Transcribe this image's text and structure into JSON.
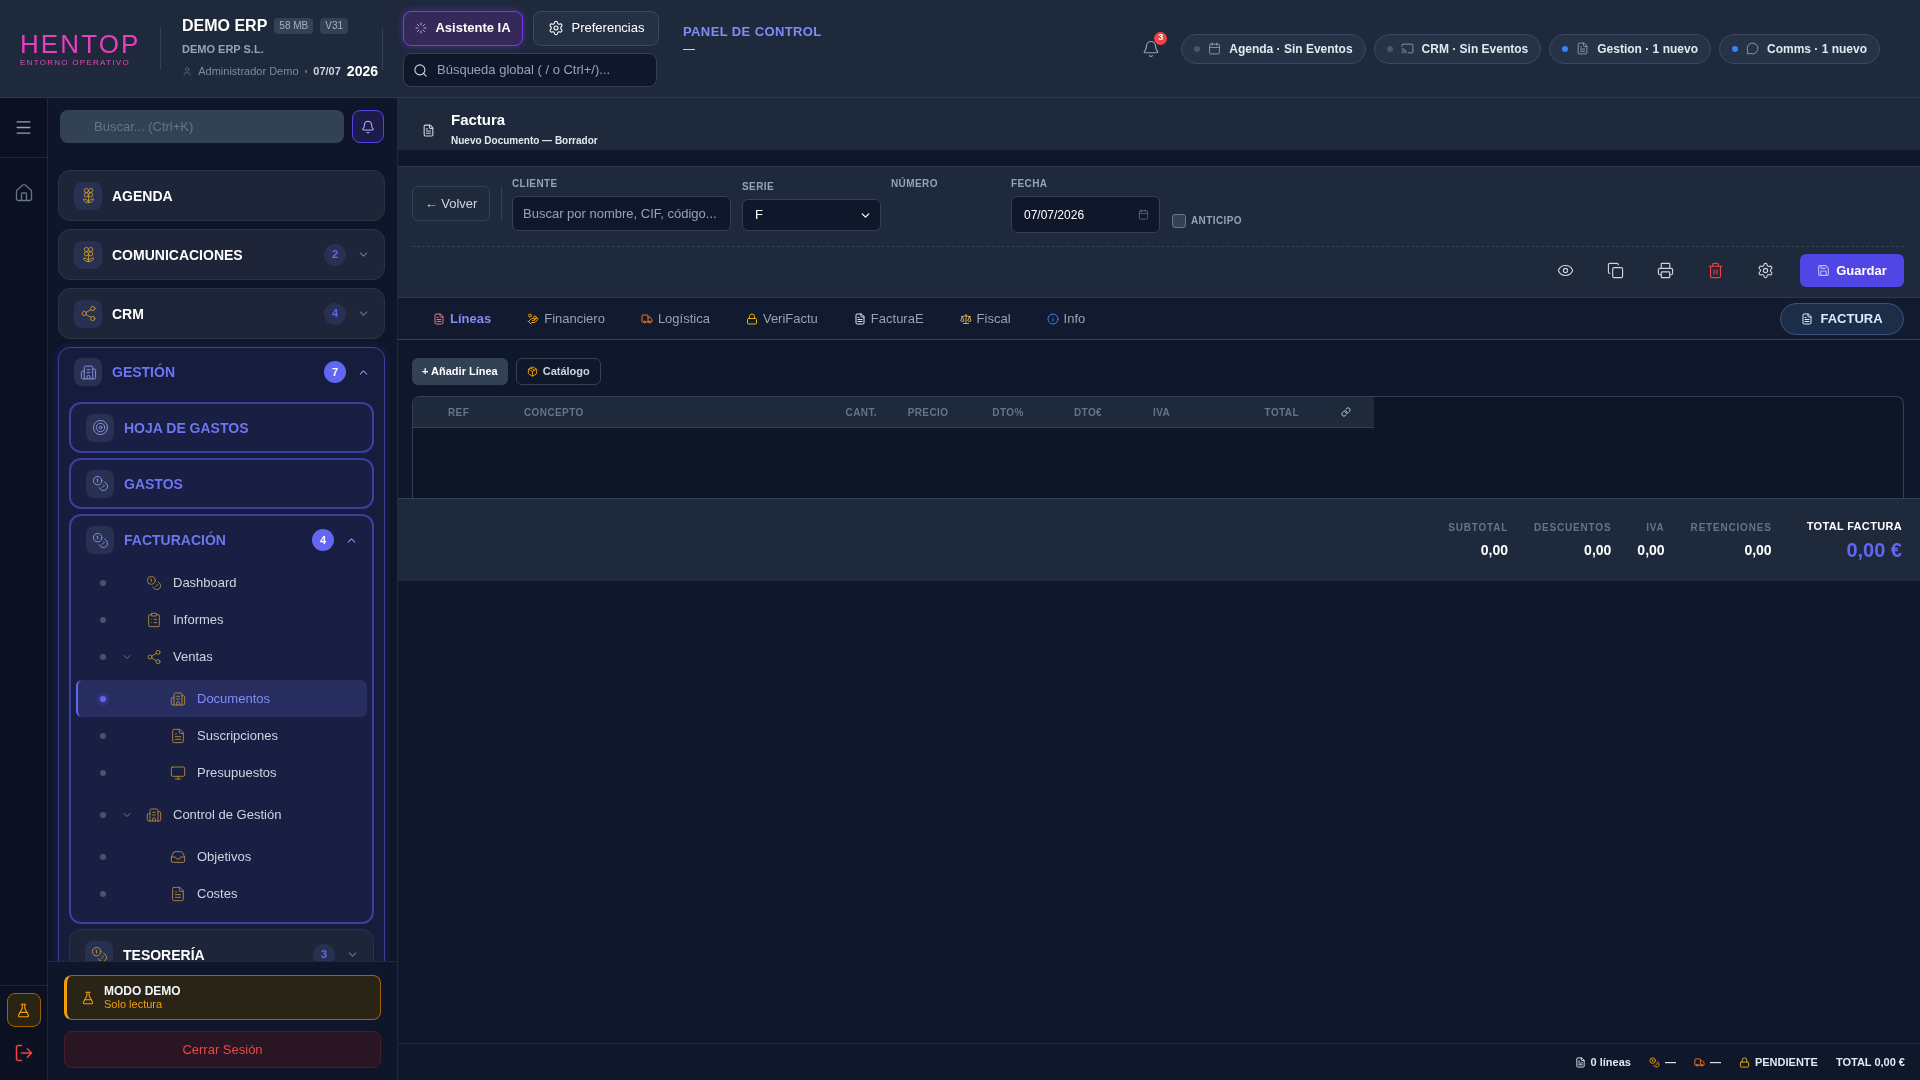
{
  "header": {
    "logo": {
      "name": "HENTOP",
      "tagline": "ENTORNO OPERATIVO"
    },
    "company": {
      "name": "DEMO ERP",
      "badges": [
        "58 MB",
        "V31"
      ],
      "legal_name": "DEMO ERP S.L.",
      "user": "Administrador Demo",
      "date": "07/07",
      "year": "2026"
    },
    "buttons": [
      {
        "label": "Asistente IA",
        "kind": "assistant"
      },
      {
        "label": "Preferencias",
        "kind": "settings"
      }
    ],
    "search": {
      "placeholder": "Búsqueda global ( / o Ctrl+/)..."
    },
    "page": {
      "title": "PANEL DE CONTROL",
      "subtitle": "—"
    },
    "notifications": {
      "count": "3"
    },
    "status_pills": [
      {
        "label": "Agenda · Sin Eventos",
        "kind": "calendar",
        "color": "#475569"
      },
      {
        "label": "CRM · Sin Eventos",
        "kind": "screen",
        "color": "#475569"
      },
      {
        "label": "Gestion · 1 nuevo",
        "kind": "document",
        "color": "#3b82f6"
      },
      {
        "label": "Comms · 1 nuevo",
        "kind": "chat",
        "color": "#3b82f6"
      }
    ]
  },
  "sidebar": {
    "search": {
      "placeholder": "Buscar... (Ctrl+K)"
    },
    "nav": [
      {
        "label": "AGENDA",
        "kind": "link",
        "active": false,
        "expanded": false
      },
      {
        "label": "COMUNICACIONES",
        "kind": "group",
        "count": "2",
        "active": false,
        "expanded": false
      },
      {
        "label": "CRM",
        "kind": "group",
        "count": "4",
        "active": false,
        "expanded": false
      },
      {
        "label": "GESTIÓN",
        "kind": "group",
        "count": "7",
        "active": true,
        "expanded": true,
        "children": [
          {
            "label": "HOJA DE GASTOS",
            "kind": "link",
            "active": true,
            "expanded": false
          },
          {
            "label": "GASTOS",
            "kind": "link",
            "active": true,
            "expanded": false
          },
          {
            "label": "FACTURACIÓN",
            "kind": "group",
            "count": "4",
            "active": true,
            "expanded": true,
            "children": [
              {
                "label": "Dashboard",
                "kind": "page",
                "selected": false,
                "expanded": false
              },
              {
                "label": "Informes",
                "kind": "page",
                "selected": false,
                "expanded": false
              },
              {
                "label": "Ventas",
                "kind": "folder",
                "selected": false,
                "expanded": true,
                "children": [
                  {
                    "label": "Documentos",
                    "kind": "page",
                    "selected": true,
                    "expanded": false
                  },
                  {
                    "label": "Suscripciones",
                    "kind": "page",
                    "selected": false,
                    "expanded": false
                  },
                  {
                    "label": "Presupuestos",
                    "kind": "page",
                    "selected": false,
                    "expanded": false
                  }
                ]
              },
              {
                "label": "Control de Gestión",
                "kind": "folder",
                "selected": false,
                "expanded": true,
                "children": [
                  {
                    "label": "Objetivos",
                    "kind": "page",
                    "selected": false,
                    "expanded": false
                  },
                  {
                    "label": "Costes",
                    "kind": "page",
                    "selected": false,
                    "expanded": false
                  }
                ]
              }
            ]
          },
          {
            "label": "TESORERÍA",
            "kind": "group",
            "count": "3",
            "active": false,
            "expanded": false
          }
        ]
      }
    ],
    "demo": {
      "title": "MODO DEMO",
      "subtitle": "Solo lectura"
    },
    "logout": "Cerrar Sesión"
  },
  "document": {
    "title": "Factura",
    "subtitle": "Nuevo Documento — Borrador"
  },
  "form": {
    "back_button": "← Volver",
    "fields": [
      {
        "label": "CLIENTE",
        "kind": "search",
        "placeholder": "Buscar por nombre, CIF, código..."
      },
      {
        "label": "SERIE",
        "kind": "select",
        "value": "F"
      },
      {
        "label": "NÚMERO",
        "kind": "readonly"
      },
      {
        "label": "FECHA",
        "kind": "date",
        "value": "07/07/2026"
      }
    ],
    "anticipo": {
      "label": "ANTICIPO",
      "checked": false
    },
    "save_button": "Guardar"
  },
  "tabs": [
    {
      "label": "Líneas",
      "selected": true
    },
    {
      "label": "Financiero",
      "selected": false
    },
    {
      "label": "Logística",
      "selected": false
    },
    {
      "label": "VeriFactu",
      "selected": false
    },
    {
      "label": "FacturaE",
      "selected": false
    },
    {
      "label": "Fiscal",
      "selected": false
    },
    {
      "label": "Info",
      "selected": false
    }
  ],
  "doc_type": "FACTURA",
  "lines": {
    "buttons": [
      {
        "label": "+ Añadir Línea",
        "kind": "primary"
      },
      {
        "label": "Catálogo",
        "kind": "catalog"
      }
    ],
    "table": {
      "columns": [
        "REF",
        "CONCEPTO",
        "CANT.",
        "PRECIO",
        "DTO%",
        "DTO€",
        "IVA",
        "TOTAL"
      ]
    }
  },
  "totals": {
    "items": [
      {
        "label": "SUBTOTAL",
        "value": "0,00"
      },
      {
        "label": "DESCUENTOS",
        "value": "0,00"
      },
      {
        "label": "IVA",
        "value": "0,00"
      },
      {
        "label": "RETENCIONES",
        "value": "0,00"
      }
    ],
    "grand_total": {
      "label": "TOTAL FACTURA",
      "value": "0,00 €"
    }
  },
  "status_bar": [
    {
      "text": "0 líneas",
      "kind": "lines"
    },
    {
      "text": "—",
      "kind": "finance"
    },
    {
      "text": "—",
      "kind": "logistics"
    },
    {
      "text": "PENDIENTE",
      "kind": "status"
    },
    {
      "text": "TOTAL 0,00 €",
      "kind": "total"
    }
  ]
}
